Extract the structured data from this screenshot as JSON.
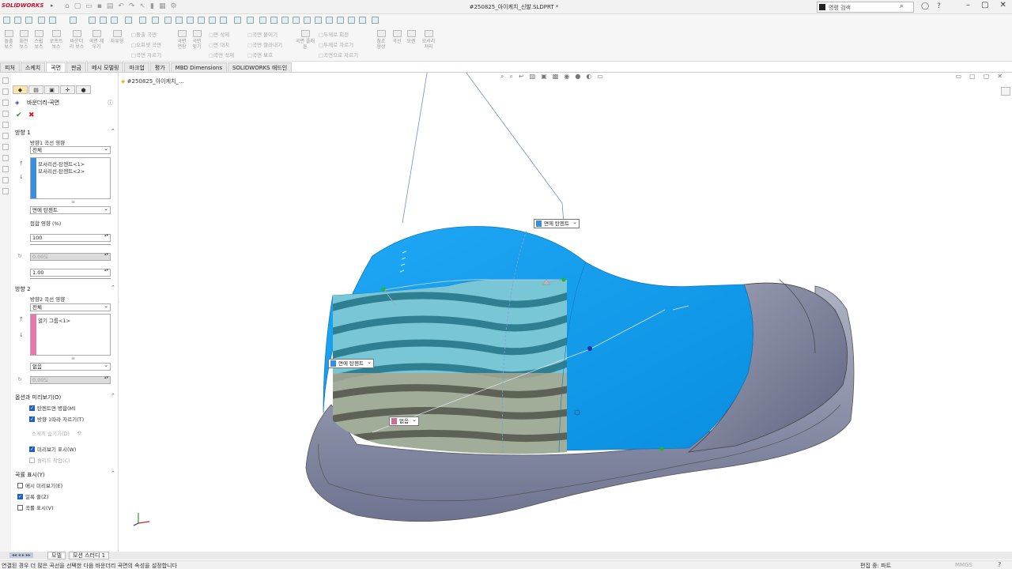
{
  "app": {
    "logo_text": "SOLIDWORKS",
    "window_title": "#250825_아이케치_신발.SLDPRT *",
    "search_placeholder": "명령 검색"
  },
  "command_manager": {
    "large_buttons": [
      "돌출 보스",
      "회전 보스",
      "스윕 보스",
      "로프트 보스",
      "바운더리 보스",
      "곡면 채우기",
      "자유형"
    ],
    "group1": [
      "돌출 곡면",
      "오프셋 곡면",
      "곡면 자르기"
    ],
    "group2": [
      "곡면 연장",
      "곡면 잇기"
    ],
    "group3": [
      "면 삭제",
      "면 대치",
      "곡면 삭제"
    ],
    "group4": [
      "곡면 붙이기",
      "곡면 잘라내기",
      "곡면 보호"
    ],
    "group5": [
      "두께로 회전",
      "두께로 자르기",
      "곡면으로 자르기"
    ],
    "group6": [
      "곡면 플래튼"
    ],
    "right_buttons": [
      "참조 형상",
      "곡선",
      "오렌",
      "모서리 처리"
    ]
  },
  "tabs": [
    "피처",
    "스케치",
    "곡면",
    "판금",
    "메시 모델링",
    "마크업",
    "평가",
    "MBD Dimensions",
    "SOLIDWORKS 애드인"
  ],
  "active_tab_index": 2,
  "property_manager": {
    "title": "바운더리-곡면",
    "direction1": {
      "header": "방향 1",
      "curve_influence_label": "방향1 곡선 영향",
      "curve_influence_value": "전체",
      "list_items": [
        "모서리선-탄젠트<1>",
        "모서리선-탄젠트<2>"
      ],
      "tangency_type": "면에 탄젠트",
      "draft_label": "접합 영향 (%)",
      "tangent_length": "100",
      "draft_angle": "0.00도",
      "tangent_influence": "1.00"
    },
    "direction2": {
      "header": "방향 2",
      "curve_influence_label": "방향2 곡선 영향",
      "curve_influence_value": "전체",
      "list_items": [
        "열기 그룹<1>"
      ],
      "tangency_type": "없음",
      "draft_angle": "0.00도"
    },
    "options": {
      "header": "옵션과 미리보기(O)",
      "items": [
        {
          "label": "탄젠트면 병합(M)",
          "checked": true,
          "disabled": false
        },
        {
          "label": "방향 1따라 자르기(T)",
          "checked": true,
          "disabled": false
        },
        {
          "label": "스케치 숨기기(D)",
          "checked": false,
          "disabled": true
        },
        {
          "label": "미리보기 표시(W)",
          "checked": true,
          "disabled": false
        },
        {
          "label": "솔리드 작업(C)",
          "checked": false,
          "disabled": true
        }
      ]
    },
    "display": {
      "header": "곡률 표시(Y)",
      "items": [
        {
          "label": "메시 미리보기(E)",
          "checked": false
        },
        {
          "label": "얼룩 줄(Z)",
          "checked": true
        },
        {
          "label": "곡률 표시(V)",
          "checked": false
        }
      ]
    }
  },
  "viewport": {
    "tree_root": "#250825_아이케치_...",
    "callouts": [
      "면에 탄젠트",
      "면에 탄젠트",
      "없음"
    ]
  },
  "bottom_tabs": [
    "모델",
    "모션 스터디 1"
  ],
  "status": {
    "message": "연결된 경우 더 많은 곡선을 선택한 다음 바운더리 곡면의 속성을 설정합니다",
    "edit": "편집 중: 파트",
    "units": "MMGS"
  },
  "colors": {
    "accent_blue": "#1f9cf0",
    "gray_shoe": "#8a8ea6",
    "pink_list": "#e879b0",
    "blue_list": "#3b8de0"
  }
}
